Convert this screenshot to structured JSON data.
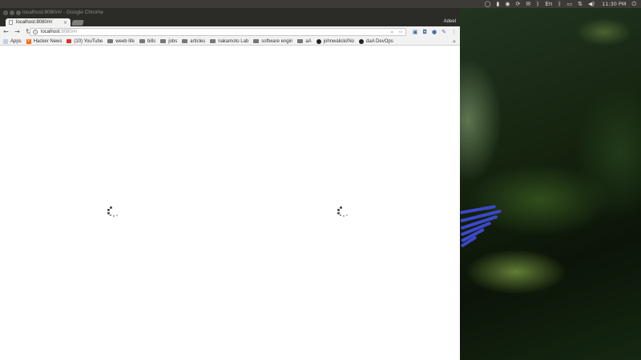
{
  "panel": {
    "clock": "11:30 PM",
    "indicators": [
      "chat-icon",
      "camera-icon",
      "chrome-icon",
      "sync-icon",
      "mail-icon",
      "bluetooth-icon",
      "keyboard-icon",
      "bluetooth-icon",
      "battery-icon",
      "network-icon",
      "volume-icon",
      "power-icon"
    ],
    "keyboard_label": "En"
  },
  "window": {
    "title": "localhost:8080/#/ - Google Chrome"
  },
  "tabs": [
    {
      "title": "localhost:8080/#/",
      "close": "×"
    }
  ],
  "profile_name": "Adeel",
  "toolbar": {
    "back": "←",
    "forward": "→",
    "reload": "↻",
    "url_host": "localhost",
    "url_path": ":8080/#/"
  },
  "bookmarks": [
    {
      "label": "Apps",
      "icon": "apps-icon"
    },
    {
      "label": "Hacker News",
      "icon": "hacker-news-icon"
    },
    {
      "label": "(10) YouTube",
      "icon": "youtube-icon"
    },
    {
      "label": "weeb life",
      "icon": "folder-icon"
    },
    {
      "label": "bills",
      "icon": "folder-icon"
    },
    {
      "label": "jobs",
      "icon": "folder-icon"
    },
    {
      "label": "articles",
      "icon": "folder-icon"
    },
    {
      "label": "nakamoto Lab",
      "icon": "folder-icon"
    },
    {
      "label": "software engin",
      "icon": "folder-icon"
    },
    {
      "label": "aA",
      "icon": "folder-icon"
    },
    {
      "label": "johnwalicki/No",
      "icon": "github-icon"
    },
    {
      "label": "daA DevOps",
      "icon": "github-icon"
    }
  ],
  "bookmarks_overflow": "»",
  "colors": {
    "panel": "#3c3b37",
    "titlebar": "#2b2b28",
    "toolbar": "#f2f2f2",
    "spinner": "#444444",
    "flower": "#3a48c8"
  }
}
